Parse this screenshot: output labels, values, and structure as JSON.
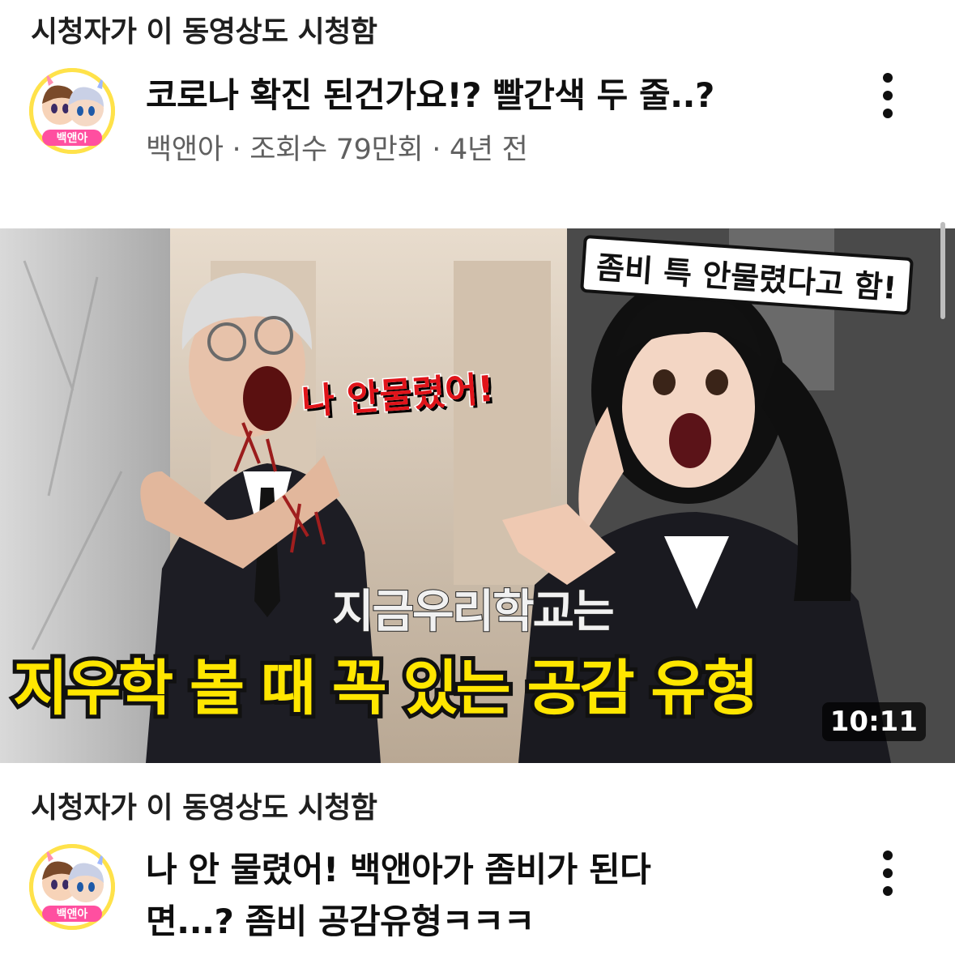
{
  "feed": [
    {
      "context_label": "시청자가 이 동영상도 시청함",
      "channel_avatar_text": "백앤아",
      "title_lines": [
        "코로나 확진 된건가요!? 빨간색 두 줄..?"
      ],
      "channel": "백앤아",
      "views": "조회수 79만회",
      "age": "4년 전",
      "separator": "·",
      "more_icon": "more-vert-icon"
    },
    {
      "context_label": "시청자가 이 동영상도 시청함",
      "channel_avatar_text": "백앤아",
      "title_lines": [
        "나 안 물렸어! 백앤아가 좀비가 된다",
        "면...? 좀비 공감유형ㅋㅋㅋ"
      ],
      "more_icon": "more-vert-icon",
      "thumbnail": {
        "bubble_text": "좀비 특 안물렸다고 함!",
        "red_text": "나 안물렸어!",
        "logo_text": "지금우리학교는",
        "caption": "지우학 볼 때 꼭 있는 공감 유형",
        "duration": "10:11"
      }
    }
  ],
  "colors": {
    "meta_text": "#606060",
    "caption_yellow": "#ffe600",
    "red_text": "#e0141a",
    "avatar_bg": "#ffe24a"
  }
}
